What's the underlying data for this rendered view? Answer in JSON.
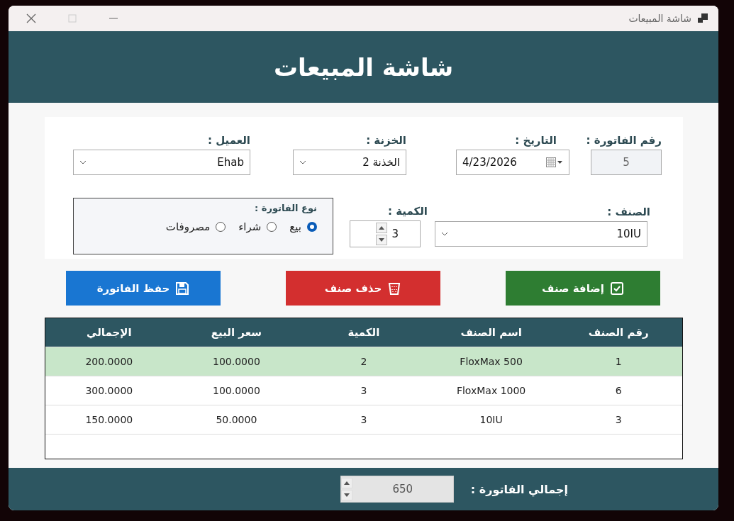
{
  "window": {
    "title": "شاشة المبيعات"
  },
  "header": {
    "title": "شاشة المبيعات"
  },
  "form": {
    "invoice_number": {
      "label": "رقم الفاتورة :",
      "value": "5"
    },
    "date": {
      "label": "التاريخ :",
      "value": "4/23/2026"
    },
    "treasury": {
      "label": "الخزنة :",
      "value": "الخذنة 2"
    },
    "customer": {
      "label": "العميل :",
      "value": "Ehab"
    },
    "item": {
      "label": "الصنف :",
      "value": "10IU"
    },
    "quantity": {
      "label": "الكمية :",
      "value": "3"
    },
    "invoice_type": {
      "label": "نوع الفاتورة :",
      "options": [
        {
          "label": "بيع",
          "selected": true
        },
        {
          "label": "شراء",
          "selected": false
        },
        {
          "label": "مصروفات",
          "selected": false
        }
      ]
    }
  },
  "buttons": [
    {
      "kind": "add",
      "label": "إضافة صنف"
    },
    {
      "kind": "delete",
      "label": "حذف صنف"
    },
    {
      "kind": "save",
      "label": "حفظ الفاتورة"
    }
  ],
  "table": {
    "columns": [
      "رقم الصنف",
      "اسم الصنف",
      "الكمية",
      "سعر البيع",
      "الإجمالي"
    ],
    "rows": [
      {
        "selected": true,
        "cells": [
          "1",
          "FloxMax 500",
          "2",
          "100.0000",
          "200.0000"
        ]
      },
      {
        "selected": false,
        "cells": [
          "6",
          "FloxMax 1000",
          "3",
          "100.0000",
          "300.0000"
        ]
      },
      {
        "selected": false,
        "cells": [
          "3",
          "10IU",
          "3",
          "50.0000",
          "150.0000"
        ]
      }
    ]
  },
  "footer": {
    "label": "إجمالي الفاتورة :",
    "value": "650"
  }
}
